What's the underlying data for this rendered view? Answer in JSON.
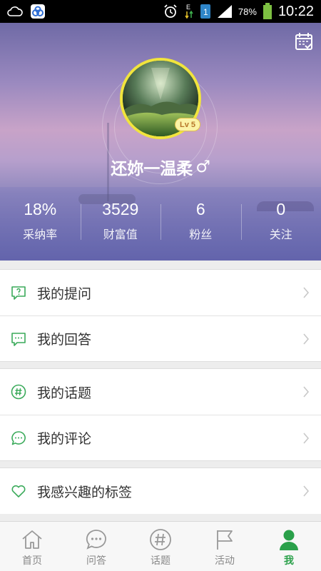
{
  "status_bar": {
    "battery_percent": "78%",
    "time": "10:22",
    "network_type": "E",
    "sim_slot": "1",
    "icons": [
      "cloud-icon",
      "baidu-cloud-icon",
      "alarm-icon",
      "data-arrows-icon",
      "sim-icon",
      "signal-icon",
      "battery-icon"
    ]
  },
  "profile": {
    "username": "还妳一温柔",
    "gender_symbol": "♂",
    "level": "Lv 5",
    "calendar_icon": "calendar-check-icon"
  },
  "stats": [
    {
      "value": "18%",
      "label": "采纳率"
    },
    {
      "value": "3529",
      "label": "财富值"
    },
    {
      "value": "6",
      "label": "粉丝"
    },
    {
      "value": "0",
      "label": "关注"
    }
  ],
  "menu_groups": [
    [
      {
        "label": "我的提问",
        "icon": "question-bubble-icon"
      },
      {
        "label": "我的回答",
        "icon": "answer-bubble-icon"
      }
    ],
    [
      {
        "label": "我的话题",
        "icon": "hashtag-circle-icon"
      },
      {
        "label": "我的评论",
        "icon": "comment-bubble-icon"
      }
    ],
    [
      {
        "label": "我感兴趣的标签",
        "icon": "heart-icon"
      }
    ]
  ],
  "tabs": [
    {
      "label": "首页",
      "icon": "home-icon",
      "active": false
    },
    {
      "label": "问答",
      "icon": "chat-dots-icon",
      "active": false
    },
    {
      "label": "话题",
      "icon": "hashtag-icon",
      "active": false
    },
    {
      "label": "活动",
      "icon": "flag-icon",
      "active": false
    },
    {
      "label": "我",
      "icon": "person-icon",
      "active": true
    }
  ],
  "colors": {
    "accent_green": "#2aa04a",
    "icon_green": "#3aaa5a",
    "avatar_ring": "#f1e43d"
  }
}
